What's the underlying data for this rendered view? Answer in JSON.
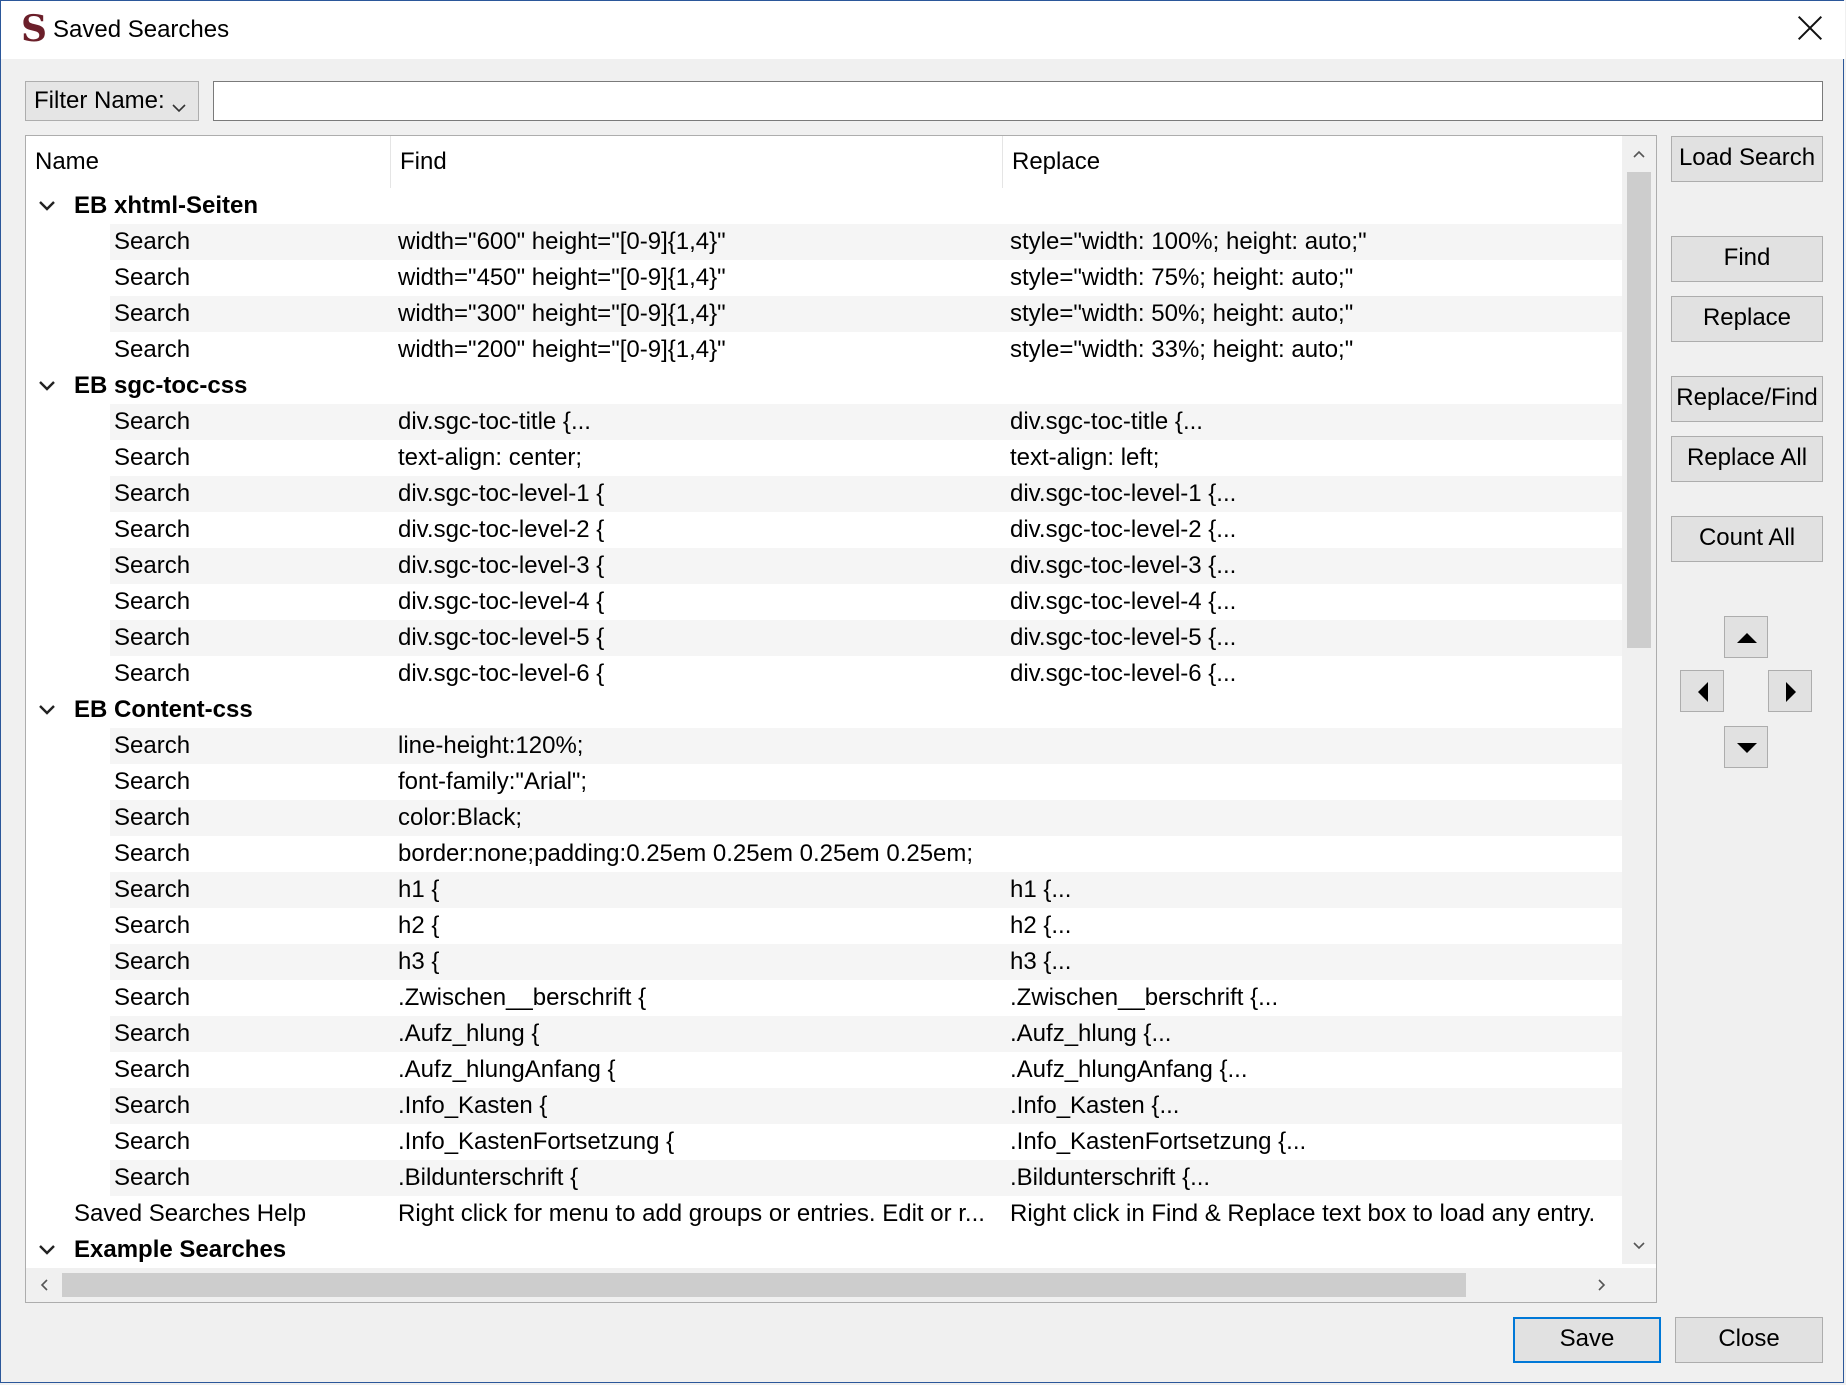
{
  "window": {
    "title": "Saved Searches",
    "app_icon_glyph": "S"
  },
  "filter": {
    "label": "Filter Name:",
    "value": ""
  },
  "table": {
    "headers": [
      "Name",
      "Find",
      "Replace"
    ],
    "rows": [
      {
        "level": 0,
        "expandable": true,
        "name": "EB xhtml-Seiten",
        "find": "",
        "replace": ""
      },
      {
        "level": 1,
        "name": "Search",
        "find": "width=\"600\" height=\"[0-9]{1,4}\"",
        "replace": "style=\"width: 100%; height: auto;\""
      },
      {
        "level": 1,
        "name": "Search",
        "find": "width=\"450\" height=\"[0-9]{1,4}\"",
        "replace": "style=\"width: 75%; height: auto;\""
      },
      {
        "level": 1,
        "name": "Search",
        "find": "width=\"300\" height=\"[0-9]{1,4}\"",
        "replace": "style=\"width: 50%; height: auto;\""
      },
      {
        "level": 1,
        "name": "Search",
        "find": "width=\"200\" height=\"[0-9]{1,4}\"",
        "replace": "style=\"width: 33%; height: auto;\""
      },
      {
        "level": 0,
        "expandable": true,
        "name": "EB sgc-toc-css",
        "find": "",
        "replace": ""
      },
      {
        "level": 1,
        "name": "Search",
        "find": "div.sgc-toc-title {...",
        "replace": "div.sgc-toc-title {..."
      },
      {
        "level": 1,
        "name": "Search",
        "find": "text-align: center;",
        "replace": "text-align: left;"
      },
      {
        "level": 1,
        "name": "Search",
        "find": "div.sgc-toc-level-1 {",
        "replace": "div.sgc-toc-level-1 {..."
      },
      {
        "level": 1,
        "name": "Search",
        "find": "div.sgc-toc-level-2 {",
        "replace": "div.sgc-toc-level-2 {..."
      },
      {
        "level": 1,
        "name": "Search",
        "find": "div.sgc-toc-level-3 {",
        "replace": "div.sgc-toc-level-3 {..."
      },
      {
        "level": 1,
        "name": "Search",
        "find": "div.sgc-toc-level-4 {",
        "replace": "div.sgc-toc-level-4 {..."
      },
      {
        "level": 1,
        "name": "Search",
        "find": "div.sgc-toc-level-5 {",
        "replace": "div.sgc-toc-level-5 {..."
      },
      {
        "level": 1,
        "name": "Search",
        "find": "div.sgc-toc-level-6 {",
        "replace": "div.sgc-toc-level-6 {..."
      },
      {
        "level": 0,
        "expandable": true,
        "name": "EB Content-css",
        "find": "",
        "replace": ""
      },
      {
        "level": 1,
        "name": "Search",
        "find": "line-height:120%;",
        "replace": ""
      },
      {
        "level": 1,
        "name": "Search",
        "find": "font-family:\"Arial\";",
        "replace": ""
      },
      {
        "level": 1,
        "name": "Search",
        "find": "color:Black;",
        "replace": ""
      },
      {
        "level": 1,
        "name": "Search",
        "find": "border:none;padding:0.25em 0.25em 0.25em 0.25em;",
        "replace": ""
      },
      {
        "level": 1,
        "name": "Search",
        "find": "h1 {",
        "replace": "h1 {..."
      },
      {
        "level": 1,
        "name": "Search",
        "find": "h2 {",
        "replace": "h2 {..."
      },
      {
        "level": 1,
        "name": "Search",
        "find": "h3 {",
        "replace": "h3 {..."
      },
      {
        "level": 1,
        "name": "Search",
        "find": ".Zwischen__berschrift {",
        "replace": ".Zwischen__berschrift {..."
      },
      {
        "level": 1,
        "name": "Search",
        "find": ".Aufz_hlung {",
        "replace": ".Aufz_hlung {..."
      },
      {
        "level": 1,
        "name": "Search",
        "find": ".Aufz_hlungAnfang {",
        "replace": ".Aufz_hlungAnfang {..."
      },
      {
        "level": 1,
        "name": "Search",
        "find": ".Info_Kasten {",
        "replace": ".Info_Kasten {..."
      },
      {
        "level": 1,
        "name": "Search",
        "find": ".Info_KastenFortsetzung {",
        "replace": ".Info_KastenFortsetzung {..."
      },
      {
        "level": 1,
        "name": "Search",
        "find": ".Bildunterschrift {",
        "replace": ".Bildunterschrift {..."
      },
      {
        "level": 0,
        "expandable": false,
        "name": "Saved Searches Help",
        "find": "Right click for menu to add groups or entries.  Edit or r...",
        "replace": "Right click in Find & Replace text box to load any entry."
      },
      {
        "level": 0,
        "expandable": true,
        "name": "Example Searches",
        "find": "",
        "replace": ""
      }
    ]
  },
  "buttons": {
    "load_search": "Load Search",
    "find": "Find",
    "replace": "Replace",
    "replace_find": "Replace/Find",
    "replace_all": "Replace All",
    "count_all": "Count All",
    "save": "Save",
    "close": "Close"
  },
  "icons": {
    "title_close": "close-icon",
    "expander": "chevron-down-icon",
    "move_up": "triangle-up-icon",
    "move_down": "triangle-down-icon",
    "move_left": "triangle-left-icon",
    "move_right": "triangle-right-icon"
  },
  "colors": {
    "accent": "#0078d7",
    "app_icon": "#6b1f2a",
    "window_border": "#2b579a"
  }
}
